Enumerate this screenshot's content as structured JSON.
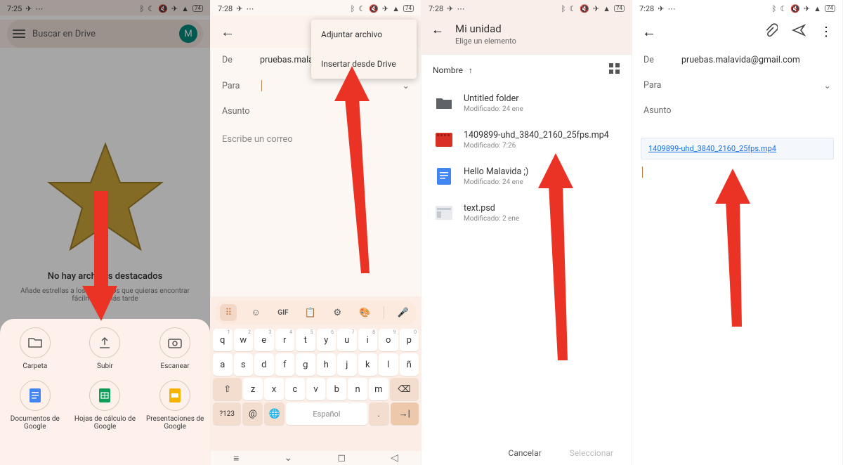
{
  "status": {
    "time1": "7:25",
    "time234": "7:28",
    "battery_text": "74"
  },
  "s1": {
    "search_placeholder": "Buscar en Drive",
    "avatar_letter": "M",
    "empty_title": "No hay archivos destacados",
    "empty_sub": "Añade estrellas a los elementos que quieras encontrar fácilmente más tarde",
    "sheet": {
      "folder": "Carpeta",
      "upload": "Subir",
      "scan": "Escanear",
      "docs": "Documentos de Google",
      "sheets": "Hojas de cálculo de Google",
      "slides": "Presentaciones de Google"
    }
  },
  "s2": {
    "from_label": "De",
    "from_value": "pruebas.malavida@g",
    "to_label": "Para",
    "subject_label": "Asunto",
    "body_placeholder": "Escribe un correo",
    "menu": {
      "attach": "Adjuntar archivo",
      "insert_drive": "Insertar desde Drive"
    },
    "kbd": {
      "row1": [
        "q",
        "w",
        "e",
        "r",
        "t",
        "y",
        "u",
        "i",
        "o",
        "p"
      ],
      "row1_sup": [
        "1",
        "2",
        "3",
        "4",
        "5",
        "6",
        "7",
        "8",
        "9",
        "0"
      ],
      "row2": [
        "a",
        "s",
        "d",
        "f",
        "g",
        "h",
        "j",
        "k",
        "l",
        "ñ"
      ],
      "row3": [
        "z",
        "x",
        "c",
        "v",
        "b",
        "n",
        "m"
      ],
      "sym": "?123",
      "space": "Español",
      "gif": "GIF"
    }
  },
  "s3": {
    "title": "Mi unidad",
    "subtitle": "Elige un elemento",
    "sort_label": "Nombre",
    "items": [
      {
        "name": "Untitled folder",
        "mod": "Modificado: 24 ene"
      },
      {
        "name": "1409899-uhd_3840_2160_25fps.mp4",
        "mod": "Modificado: 7:26"
      },
      {
        "name": "Hello Malavida ;)",
        "mod": "Modificado: 24 ene"
      },
      {
        "name": "text.psd",
        "mod": "Modificado: 2 ene"
      }
    ],
    "cancel": "Cancelar",
    "select": "Seleccionar"
  },
  "s4": {
    "from_label": "De",
    "from_value": "pruebas.malavida@gmail.com",
    "to_label": "Para",
    "subject_label": "Asunto",
    "attachment": "1409899-uhd_3840_2160_25fps.mp4"
  }
}
